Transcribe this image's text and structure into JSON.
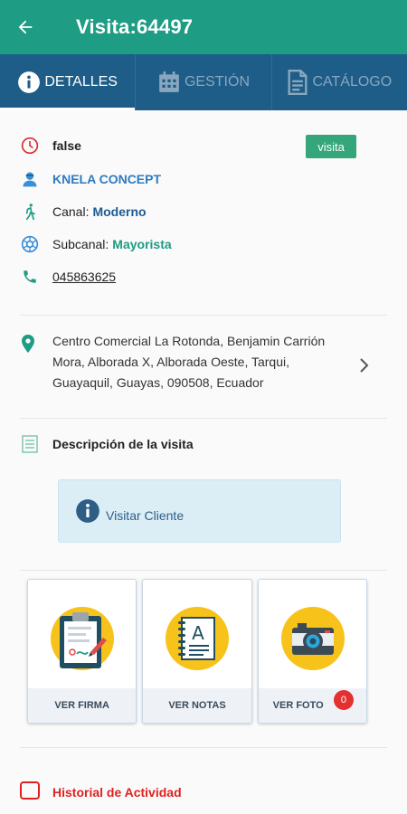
{
  "header": {
    "title": "Visita:64497",
    "back_icon": "arrow-left-icon",
    "background": "#1e9c84"
  },
  "tabs": [
    {
      "label": "DETALLES",
      "icon": "info-icon",
      "active": true
    },
    {
      "label": "GESTIÓN",
      "icon": "calendar-icon",
      "active": false
    },
    {
      "label": "CATÁLOGO",
      "icon": "document-icon",
      "active": false
    }
  ],
  "details": {
    "status": "false",
    "badge": "visita",
    "client": "KNELA CONCEPT",
    "canal_label": "Canal:",
    "canal_value": "Moderno",
    "subcanal_label": "Subcanal:",
    "subcanal_value": "Mayorista",
    "phone": "045863625",
    "address": "Centro Comercial La Rotonda, Benjamin Carrión Mora, Alborada X, Alborada Oeste, Tarqui, Guayaquil, Guayas, 090508, Ecuador",
    "description_title": "Descripción de la visita"
  },
  "notice": {
    "text": "Visitar Cliente"
  },
  "cards": [
    {
      "label": "VER FIRMA",
      "icon": "clipboard-signature-icon"
    },
    {
      "label": "VER NOTAS",
      "icon": "notebook-icon"
    },
    {
      "label": "VER FOTO",
      "icon": "camera-icon",
      "count": "0"
    }
  ],
  "history": {
    "label": "Historial de Actividad"
  },
  "colors": {
    "primary": "#1e9c84",
    "tabs": "#1d5d87",
    "accent_red": "#e02020"
  }
}
